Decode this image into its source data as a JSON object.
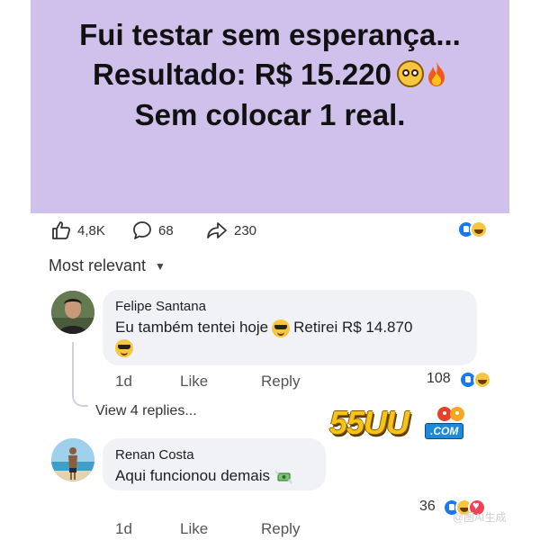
{
  "post": {
    "headline": {
      "line1": "Fui testar sem esperança...",
      "line2": "Resultado: R$ 15.220",
      "line3": "Sem colocar 1 real."
    },
    "stats": {
      "likes": "4,8K",
      "comments": "68",
      "shares": "230"
    },
    "sort_label": "Most relevant"
  },
  "comments": [
    {
      "author": "Felipe Santana",
      "text_part1": "Eu também tentei hoje",
      "text_part2": "Retirei R$ 14.870",
      "time": "1d",
      "like_label": "Like",
      "reply_label": "Reply",
      "reaction_count": "108",
      "view_replies": "View 4 replies..."
    },
    {
      "author": "Renan Costa",
      "text": "Aqui funcionou demais",
      "time": "1d",
      "like_label": "Like",
      "reply_label": "Reply",
      "reaction_count": "36"
    }
  ],
  "logo": {
    "text": "55UU",
    "sub": ".COM"
  },
  "watermark": "@图AI生成",
  "icons": {
    "like": "thumbs-up-icon",
    "comment": "comment-bubble-icon",
    "share": "share-arrow-icon",
    "emoji_1": "flushed-face-emoji",
    "emoji_2": "fire-emoji",
    "emoji_3": "sunglasses-emoji",
    "emoji_4": "money-with-wings-emoji"
  },
  "colors": {
    "banner_bg": "#cfc0ec",
    "like_blue": "#1877f2",
    "bubble_bg": "#f0f2f5"
  }
}
